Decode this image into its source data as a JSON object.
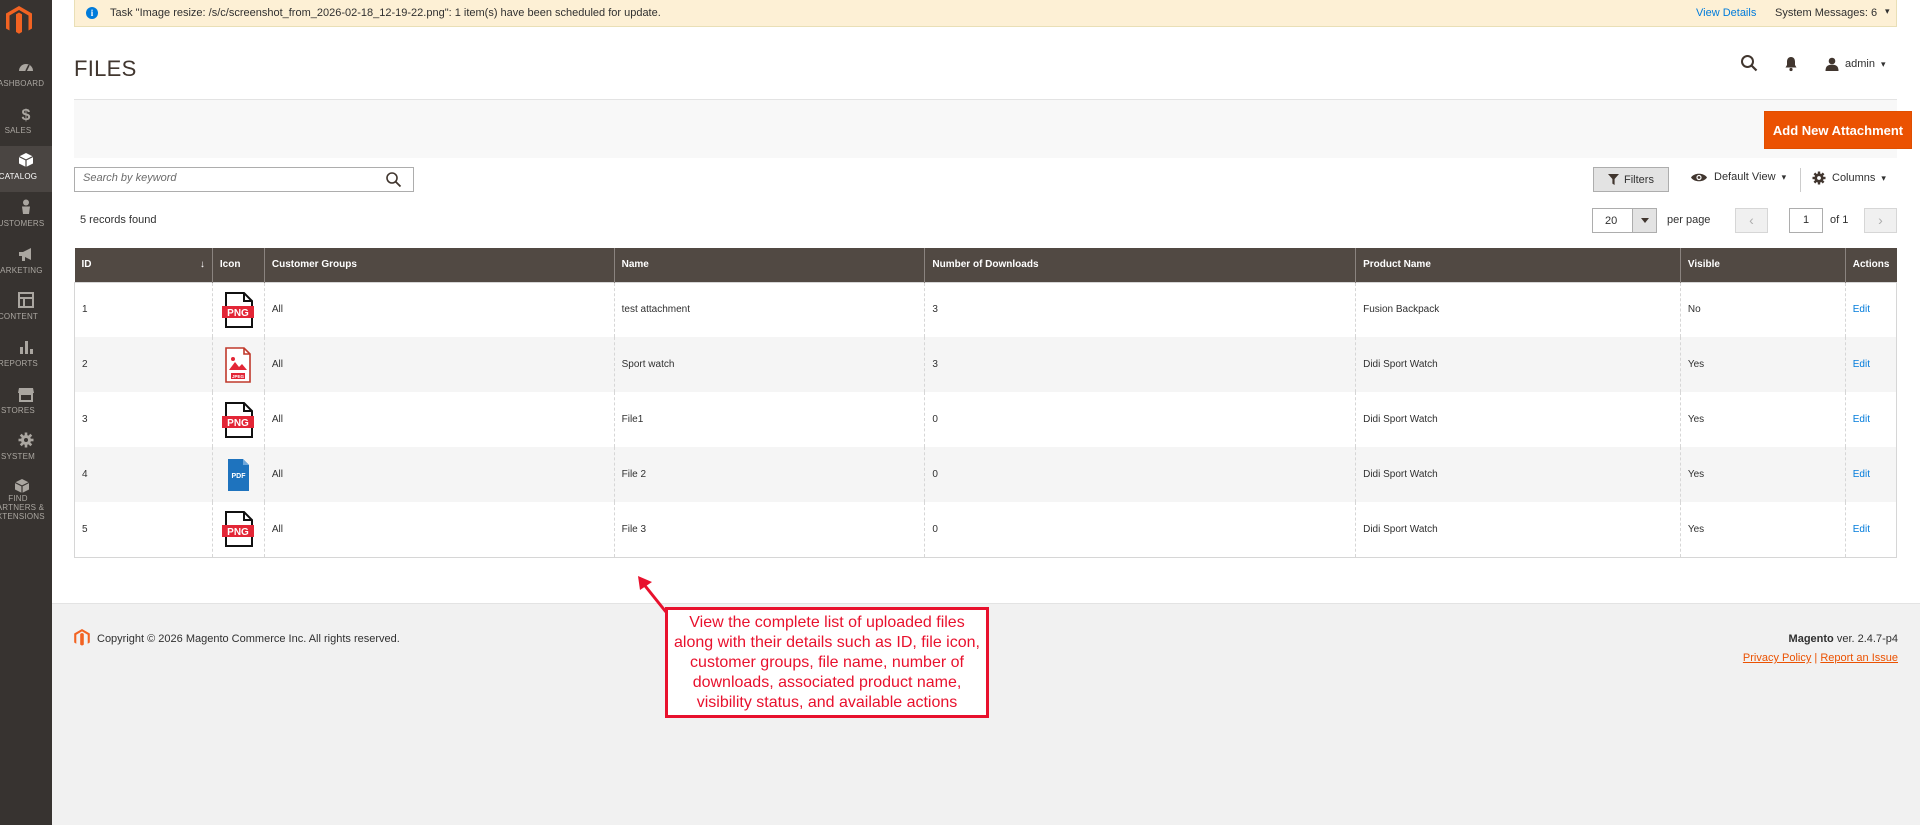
{
  "sidebar": {
    "items": [
      {
        "label": "DASHBOARD",
        "icon": "dashboard-icon"
      },
      {
        "label": "SALES",
        "icon": "dollar-icon"
      },
      {
        "label": "CATALOG",
        "icon": "cube-icon",
        "active": true
      },
      {
        "label": "CUSTOMERS",
        "icon": "person-icon"
      },
      {
        "label": "MARKETING",
        "icon": "megaphone-icon"
      },
      {
        "label": "CONTENT",
        "icon": "layout-icon"
      },
      {
        "label": "REPORTS",
        "icon": "bar-chart-icon"
      },
      {
        "label": "STORES",
        "icon": "store-icon"
      },
      {
        "label": "SYSTEM",
        "icon": "gear-icon"
      },
      {
        "label": "FIND PARTNERS & EXTENSIONS",
        "icon": "box-icon"
      }
    ]
  },
  "system_message": {
    "text": "Task \"Image resize: /s/c/screenshot_from_2026-02-18_12-19-22.png\": 1 item(s) have been scheduled for update.",
    "view_details": "View Details",
    "system_messages": "System Messages: 6"
  },
  "header": {
    "title": "FILES",
    "user": "admin"
  },
  "toolbar": {
    "add_button": "Add New Attachment",
    "search_placeholder": "Search by keyword",
    "filters": "Filters",
    "default_view": "Default View",
    "columns": "Columns",
    "records_found": "5 records found",
    "per_page_value": "20",
    "per_page_label": "per page",
    "page_current": "1",
    "page_of": "of 1"
  },
  "table": {
    "headers": [
      "ID",
      "Icon",
      "Customer Groups",
      "Name",
      "Number of Downloads",
      "Product Name",
      "Visible",
      "Actions"
    ],
    "rows": [
      {
        "id": "1",
        "icon": "png",
        "groups": "All",
        "name": "test attachment",
        "downloads": "3",
        "product": "Fusion Backpack",
        "visible": "No",
        "action": "Edit"
      },
      {
        "id": "2",
        "icon": "jpeg",
        "groups": "All",
        "name": "Sport watch",
        "downloads": "3",
        "product": "Didi Sport Watch",
        "visible": "Yes",
        "action": "Edit"
      },
      {
        "id": "3",
        "icon": "png",
        "groups": "All",
        "name": "File1",
        "downloads": "0",
        "product": "Didi Sport Watch",
        "visible": "Yes",
        "action": "Edit"
      },
      {
        "id": "4",
        "icon": "pdf",
        "groups": "All",
        "name": "File 2",
        "downloads": "0",
        "product": "Didi Sport Watch",
        "visible": "Yes",
        "action": "Edit"
      },
      {
        "id": "5",
        "icon": "png",
        "groups": "All",
        "name": "File 3",
        "downloads": "0",
        "product": "Didi Sport Watch",
        "visible": "Yes",
        "action": "Edit"
      }
    ]
  },
  "icon_labels": {
    "png": "PNG",
    "pdf": "PDF",
    "jpeg": "JPEG"
  },
  "footer": {
    "copyright": "Copyright © 2026 Magento Commerce Inc. All rights reserved.",
    "brand": "Magento",
    "version": " ver. 2.4.7-p4",
    "privacy": "Privacy Policy",
    "separator": "|",
    "report": "Report an Issue"
  },
  "annotation": {
    "text": "View the complete list of uploaded files along with their details such as ID, file icon, customer groups, file name, number of downloads, associated product name, visibility status, and available actions"
  },
  "colors": {
    "accent": "#eb5202",
    "link": "#007bdb",
    "header_bg": "#514943",
    "sidebar_bg": "#373330",
    "annotation": "#e8112d"
  }
}
